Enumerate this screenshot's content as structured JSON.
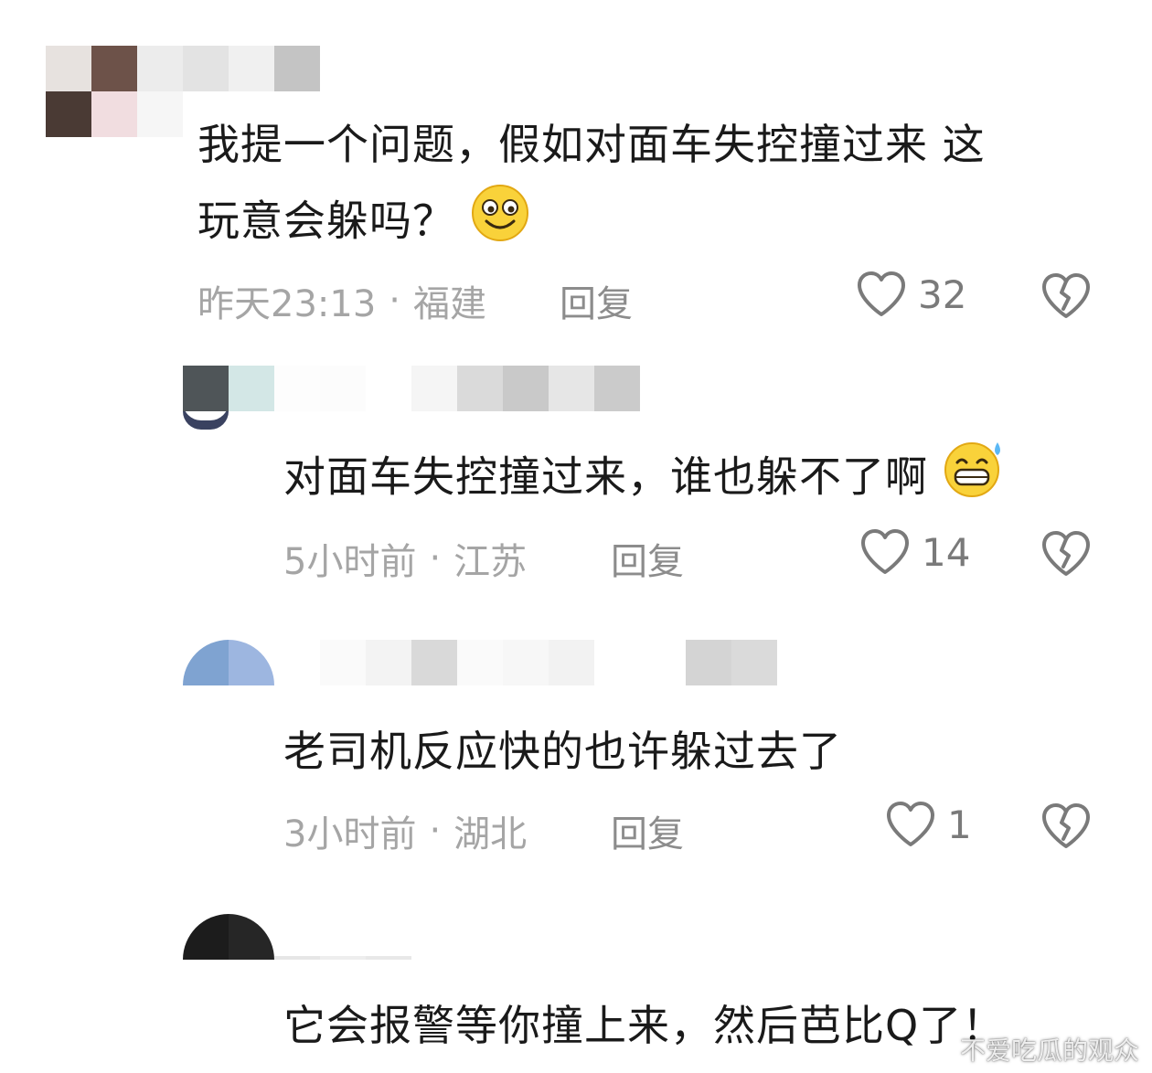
{
  "comments": [
    {
      "text_line1": "我提一个问题，假如对面车失控撞过来 这",
      "text_line2": "玩意会躲吗？",
      "emoji_icon": "smile-emoji-icon",
      "time": "昨天23:13",
      "location": "福建",
      "reply_label": "回复",
      "likes": "32"
    },
    {
      "text": "对面车失控撞过来，谁也躲不了啊",
      "emoji_icon": "sweat-grin-emoji-icon",
      "time": "5小时前",
      "location": "江苏",
      "reply_label": "回复",
      "likes": "14"
    },
    {
      "text": "老司机反应快的也许躲过去了",
      "time": "3小时前",
      "location": "湖北",
      "reply_label": "回复",
      "likes": "1"
    },
    {
      "text": "它会报警等你撞上来，然后芭比Q了！"
    }
  ],
  "separator": "·",
  "watermark": "不爱吃瓜的观众",
  "colors": {
    "text": "#1a1a1a",
    "meta": "#a5a5a5",
    "icon": "#7a7a7a"
  }
}
